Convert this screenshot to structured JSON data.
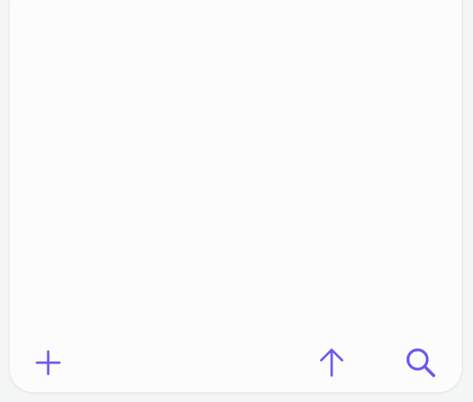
{
  "theme": {
    "accent": "#6a5af0",
    "surface": "#fcfcfc",
    "background": "#f4f6f5"
  },
  "toolbar": {
    "add_icon": "plus-icon",
    "scroll_top_icon": "arrow-up-icon",
    "search_icon": "search-icon"
  }
}
